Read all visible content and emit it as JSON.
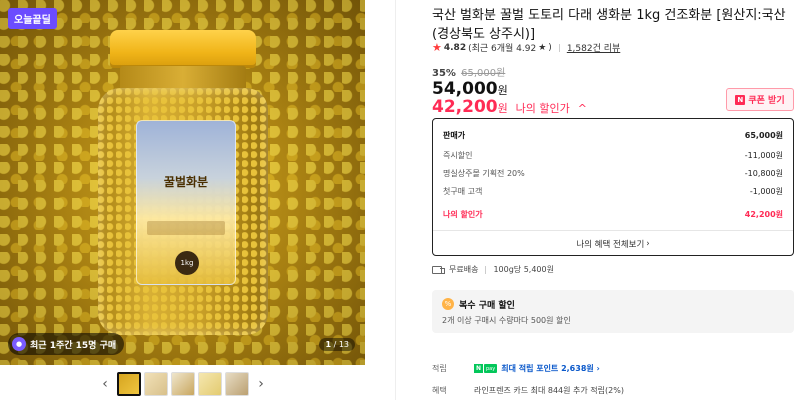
{
  "gallery": {
    "badge": "오늘끝딜",
    "label_title": "꿀벌화분",
    "label_weight": "1kg",
    "review_pill": "최근 1주간 15명 구매",
    "counter_current": "1",
    "counter_total": "/ 13",
    "prev_icon": "‹",
    "next_icon": "›"
  },
  "product": {
    "title": "국산 벌화분 꿀벌 도토리 다래 생화분 1kg 건조화분 [원산지:국산(경상북도 상주시)]",
    "rating": "4.82",
    "recent_rating": "(최근 6개월 4.92",
    "recent_rating_end": ")",
    "review_count": "1,582건 리뷰",
    "discount_pct": "35%",
    "original_price": "65,000원",
    "price": "54,000",
    "price_unit": "원",
    "my_price": "42,200",
    "my_price_unit": "원",
    "my_price_label": "나의 할인가",
    "coupon_label": "쿠폰 받기"
  },
  "price_box": {
    "rows": [
      {
        "label": "판매가",
        "value": "65,000원"
      },
      {
        "label": "즉시할인",
        "value": "-11,000원"
      },
      {
        "label": "명실상주몰 기획전 20%",
        "value": "-10,800원"
      },
      {
        "label": "첫구매 고객",
        "value": "-1,000원"
      },
      {
        "label": "나의 할인가",
        "value": "42,200원"
      }
    ],
    "benefit_link": "나의 혜택 전체보기"
  },
  "shipping": {
    "free": "무료배송",
    "unit_price": "100g당 5,400원"
  },
  "multi_discount": {
    "title": "복수 구매 할인",
    "desc": "2개 이상 구매시 수량마다 500원 할인"
  },
  "points": {
    "label": "적립",
    "text": "최대 적립 포인트 2,638원",
    "pay_badge": "pay"
  },
  "benefit": {
    "label": "혜택",
    "text": "라인프렌즈 카드 최대 844원 추가 적립(2%)"
  },
  "colors": {
    "accent_red": "#ff2b55",
    "badge_purple": "#6b4cff",
    "naver_green": "#03c75a"
  }
}
